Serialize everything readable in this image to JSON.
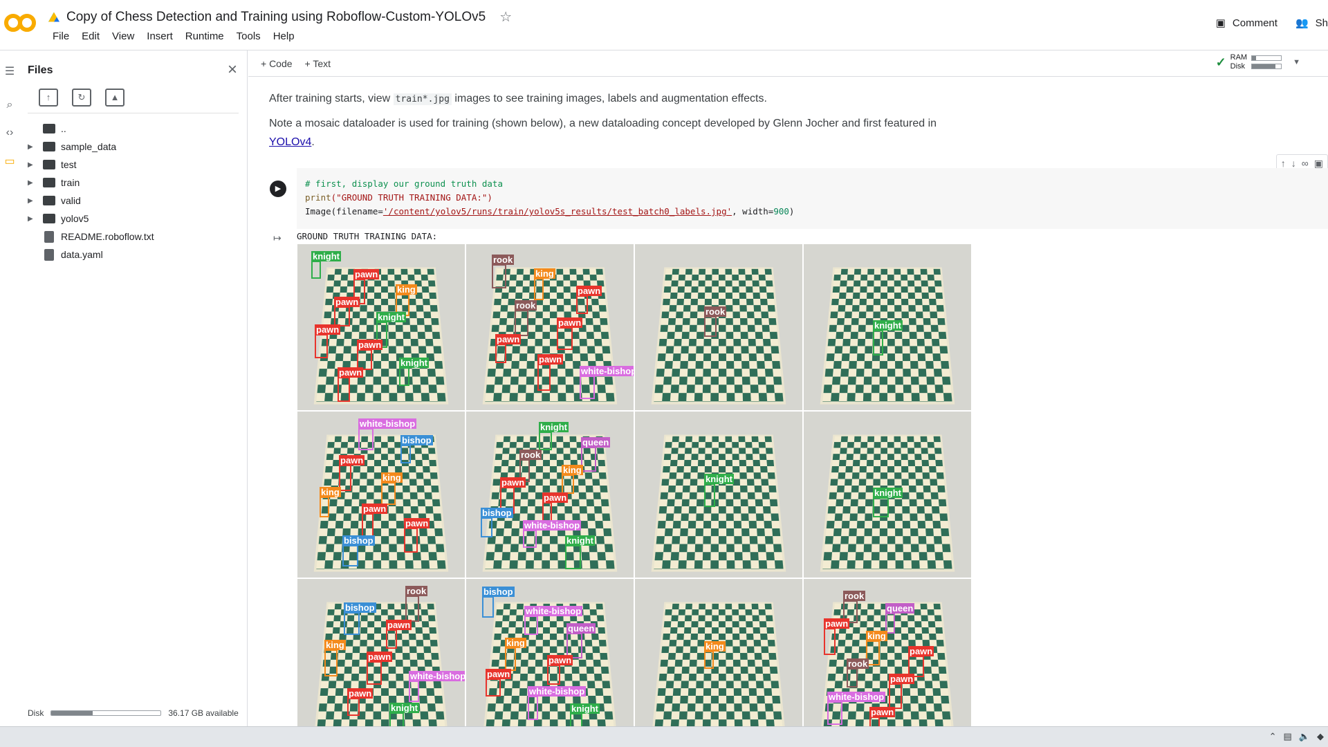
{
  "window": {
    "title": "Copy of Chess Detection and Training using Roboflow-Custom-YOLOv5"
  },
  "menu": [
    "File",
    "Edit",
    "View",
    "Insert",
    "Runtime",
    "Tools",
    "Help"
  ],
  "top_right": {
    "comment": "Comment",
    "share": "Sh"
  },
  "files_panel": {
    "title": "Files",
    "tree": [
      {
        "label": "..",
        "type": "parent"
      },
      {
        "label": "sample_data",
        "type": "folder"
      },
      {
        "label": "test",
        "type": "folder"
      },
      {
        "label": "train",
        "type": "folder"
      },
      {
        "label": "valid",
        "type": "folder"
      },
      {
        "label": "yolov5",
        "type": "folder"
      },
      {
        "label": "README.roboflow.txt",
        "type": "file"
      },
      {
        "label": "data.yaml",
        "type": "file"
      }
    ],
    "disk_label": "Disk",
    "disk_available": "36.17 GB available",
    "disk_fraction": 0.38
  },
  "toolbar": {
    "code": "+ Code",
    "text": "+ Text",
    "ram": "RAM",
    "disk": "Disk",
    "ram_fraction": 0.15,
    "disk_fraction": 0.8
  },
  "text_cell": {
    "p1_before": "After training starts, view ",
    "p1_code": "train*.jpg",
    "p1_after": " images to see training images, labels and augmentation effects.",
    "p2": "Note a mosaic dataloader is used for training (shown below), a new dataloading concept developed by Glenn Jocher and first featured in",
    "p2_link": "YOLOv4",
    "p2_end": "."
  },
  "code_cell": {
    "line1": "# first, display our ground truth data",
    "line2_fn": "print",
    "line2_str": "(\"GROUND TRUTH TRAINING DATA:\")",
    "line3_fn": "Image",
    "line3_a": "(filename=",
    "line3_str": "'/content/yolov5/runs/train/yolov5s_results/test_batch0_labels.jpg'",
    "line3_b": ", width=",
    "line3_num": "900",
    "line3_c": ")"
  },
  "output": {
    "text": "GROUND TRUTH TRAINING DATA:"
  },
  "mosaic_labels": [
    [
      "knight",
      "pawn",
      "king",
      "pawn",
      "knight",
      "pawn",
      "pawn",
      "knight",
      "pawn"
    ],
    [
      "rook",
      "king",
      "pawn",
      "rook",
      "pawn",
      "pawn",
      "pawn",
      "white-bishop"
    ],
    [
      "rook"
    ],
    [
      "knight"
    ],
    [
      "white-bishop",
      "bishop",
      "pawn",
      "king",
      "king",
      "pawn",
      "pawn",
      "bishop"
    ],
    [
      "knight",
      "queen",
      "rook",
      "king",
      "pawn",
      "pawn",
      "bishop",
      "white-bishop",
      "knight"
    ],
    [
      "knight"
    ],
    [
      "knight"
    ],
    [
      "rook",
      "bishop",
      "pawn",
      "king",
      "pawn",
      "white-bishop",
      "pawn",
      "knight"
    ],
    [
      "bishop",
      "white-bishop",
      "queen",
      "king",
      "pawn",
      "pawn",
      "white-bishop",
      "knight"
    ],
    [
      "king"
    ],
    [
      "rook",
      "queen",
      "pawn",
      "king",
      "pawn",
      "rook",
      "pawn",
      "white-bishop",
      "pawn"
    ]
  ],
  "colors": {
    "pawn": "#e8342c",
    "knight": "#2fae4a",
    "king": "#f48a1c",
    "bishop": "#3a8fd6",
    "rook": "#8c5a5a",
    "queen": "#c25ec7",
    "white-bishop": "#d96de0"
  }
}
